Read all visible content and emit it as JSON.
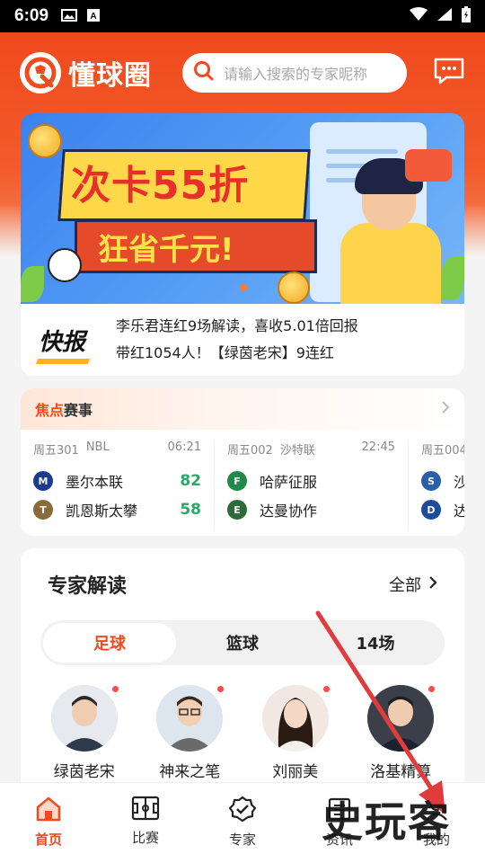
{
  "status_bar": {
    "time": "6:09"
  },
  "header": {
    "app_name": "懂球圈",
    "search_placeholder": "请输入搜索的专家昵称"
  },
  "banner": {
    "headline": "次卡55折",
    "subline": "狂省千元!"
  },
  "news": {
    "badge": "快报",
    "line1": "李乐君连红9场解读，喜收5.01倍回报",
    "line2": "带红1054人！【绿茵老宋】9连红"
  },
  "focus": {
    "title_accent": "焦点",
    "title_rest": "赛事",
    "matches": [
      {
        "code": "周五301",
        "league": "NBL",
        "time": "06:21",
        "home": "墨尔本联",
        "home_score": "82",
        "away": "凯恩斯太攀",
        "away_score": "58"
      },
      {
        "code": "周五002",
        "league": "沙特联",
        "time": "22:45",
        "home": "哈萨征服",
        "home_score": "",
        "away": "达曼协作",
        "away_score": ""
      },
      {
        "code": "周五004",
        "league": "",
        "time": "",
        "home": "沙",
        "home_score": "",
        "away": "达",
        "away_score": ""
      }
    ]
  },
  "experts": {
    "title": "专家解读",
    "view_all": "全部",
    "tabs": [
      "足球",
      "篮球",
      "14场"
    ],
    "active_tab": 0,
    "list": [
      {
        "name": "绿茵老宋"
      },
      {
        "name": "神来之笔"
      },
      {
        "name": "刘丽美"
      },
      {
        "name": "洛基精算"
      }
    ]
  },
  "bottom_nav": {
    "items": [
      {
        "label": "首页",
        "icon": "home-icon",
        "active": true
      },
      {
        "label": "比赛",
        "icon": "pitch-icon",
        "active": false
      },
      {
        "label": "专家",
        "icon": "badge-check-icon",
        "active": false
      },
      {
        "label": "资讯",
        "icon": "news-icon",
        "active": false
      },
      {
        "label": "我的",
        "icon": "user-icon",
        "active": false
      }
    ]
  },
  "overlay": {
    "watermark": "史玩客"
  },
  "colors": {
    "brand": "#f04a1e",
    "score_green": "#2aa86a",
    "live_dot": "#ff4a4a"
  }
}
